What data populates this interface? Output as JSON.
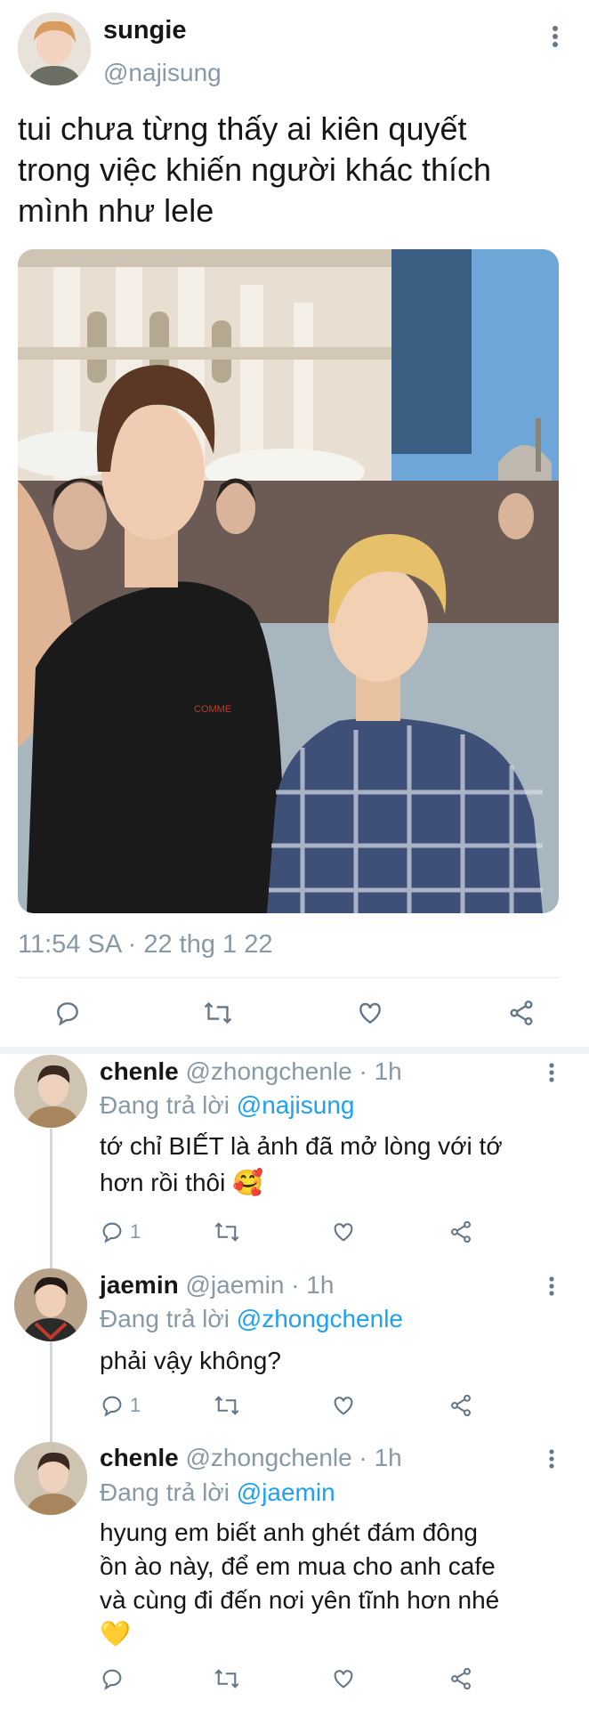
{
  "main_tweet": {
    "display_name": "sungie",
    "handle": "@najisung",
    "text_lines": [
      "tui chưa từng thấy ai kiên quyết",
      "trong việc khiến người khác thích",
      "mình như lele"
    ],
    "timestamp": "11:54 SA · 22 thg 1 22",
    "more_icon": "more-vertical-icon",
    "photo_text": "COMME"
  },
  "replies": [
    {
      "display_name": "chenle",
      "handle_time": "@zhongchenle · 1h",
      "replying_prefix": "Đang trả lời",
      "replying_to": "@najisung",
      "text_lines": [
        "tớ chỉ BIẾT là ảnh đã mở lòng với tớ",
        "hơn rồi thôi 🥰"
      ],
      "reply_count": "1"
    },
    {
      "display_name": "jaemin",
      "handle_time": "@jaemin · 1h",
      "replying_prefix": "Đang trả lời",
      "replying_to": "@zhongchenle",
      "text_lines": [
        "phải vậy không?"
      ],
      "reply_count": "1"
    },
    {
      "display_name": "chenle",
      "handle_time": "@zhongchenle · 1h",
      "replying_prefix": "Đang trả lời",
      "replying_to": "@jaemin",
      "text_lines": [
        "hyung em biết anh ghét đám đông",
        "ồn ào này, để em mua cho anh cafe",
        "và cùng đi đến nơi yên tĩnh hơn nhé",
        "💛"
      ],
      "reply_count": ""
    }
  ],
  "icons": {
    "reply": "reply-icon",
    "retweet": "retweet-icon",
    "like": "heart-icon",
    "share": "share-icon"
  },
  "colors": {
    "link": "#1da1f2",
    "secondary_text": "#8899a6",
    "text": "#14171a"
  }
}
